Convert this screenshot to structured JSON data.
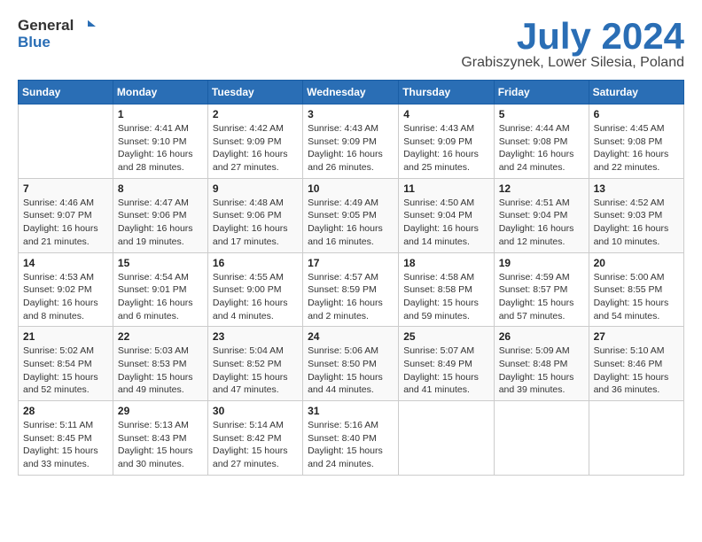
{
  "header": {
    "logo_general": "General",
    "logo_blue": "Blue",
    "month_title": "July 2024",
    "location": "Grabiszynek, Lower Silesia, Poland"
  },
  "calendar": {
    "days_of_week": [
      "Sunday",
      "Monday",
      "Tuesday",
      "Wednesday",
      "Thursday",
      "Friday",
      "Saturday"
    ],
    "weeks": [
      [
        {
          "day": "",
          "info": ""
        },
        {
          "day": "1",
          "info": "Sunrise: 4:41 AM\nSunset: 9:10 PM\nDaylight: 16 hours\nand 28 minutes."
        },
        {
          "day": "2",
          "info": "Sunrise: 4:42 AM\nSunset: 9:09 PM\nDaylight: 16 hours\nand 27 minutes."
        },
        {
          "day": "3",
          "info": "Sunrise: 4:43 AM\nSunset: 9:09 PM\nDaylight: 16 hours\nand 26 minutes."
        },
        {
          "day": "4",
          "info": "Sunrise: 4:43 AM\nSunset: 9:09 PM\nDaylight: 16 hours\nand 25 minutes."
        },
        {
          "day": "5",
          "info": "Sunrise: 4:44 AM\nSunset: 9:08 PM\nDaylight: 16 hours\nand 24 minutes."
        },
        {
          "day": "6",
          "info": "Sunrise: 4:45 AM\nSunset: 9:08 PM\nDaylight: 16 hours\nand 22 minutes."
        }
      ],
      [
        {
          "day": "7",
          "info": "Sunrise: 4:46 AM\nSunset: 9:07 PM\nDaylight: 16 hours\nand 21 minutes."
        },
        {
          "day": "8",
          "info": "Sunrise: 4:47 AM\nSunset: 9:06 PM\nDaylight: 16 hours\nand 19 minutes."
        },
        {
          "day": "9",
          "info": "Sunrise: 4:48 AM\nSunset: 9:06 PM\nDaylight: 16 hours\nand 17 minutes."
        },
        {
          "day": "10",
          "info": "Sunrise: 4:49 AM\nSunset: 9:05 PM\nDaylight: 16 hours\nand 16 minutes."
        },
        {
          "day": "11",
          "info": "Sunrise: 4:50 AM\nSunset: 9:04 PM\nDaylight: 16 hours\nand 14 minutes."
        },
        {
          "day": "12",
          "info": "Sunrise: 4:51 AM\nSunset: 9:04 PM\nDaylight: 16 hours\nand 12 minutes."
        },
        {
          "day": "13",
          "info": "Sunrise: 4:52 AM\nSunset: 9:03 PM\nDaylight: 16 hours\nand 10 minutes."
        }
      ],
      [
        {
          "day": "14",
          "info": "Sunrise: 4:53 AM\nSunset: 9:02 PM\nDaylight: 16 hours\nand 8 minutes."
        },
        {
          "day": "15",
          "info": "Sunrise: 4:54 AM\nSunset: 9:01 PM\nDaylight: 16 hours\nand 6 minutes."
        },
        {
          "day": "16",
          "info": "Sunrise: 4:55 AM\nSunset: 9:00 PM\nDaylight: 16 hours\nand 4 minutes."
        },
        {
          "day": "17",
          "info": "Sunrise: 4:57 AM\nSunset: 8:59 PM\nDaylight: 16 hours\nand 2 minutes."
        },
        {
          "day": "18",
          "info": "Sunrise: 4:58 AM\nSunset: 8:58 PM\nDaylight: 15 hours\nand 59 minutes."
        },
        {
          "day": "19",
          "info": "Sunrise: 4:59 AM\nSunset: 8:57 PM\nDaylight: 15 hours\nand 57 minutes."
        },
        {
          "day": "20",
          "info": "Sunrise: 5:00 AM\nSunset: 8:55 PM\nDaylight: 15 hours\nand 54 minutes."
        }
      ],
      [
        {
          "day": "21",
          "info": "Sunrise: 5:02 AM\nSunset: 8:54 PM\nDaylight: 15 hours\nand 52 minutes."
        },
        {
          "day": "22",
          "info": "Sunrise: 5:03 AM\nSunset: 8:53 PM\nDaylight: 15 hours\nand 49 minutes."
        },
        {
          "day": "23",
          "info": "Sunrise: 5:04 AM\nSunset: 8:52 PM\nDaylight: 15 hours\nand 47 minutes."
        },
        {
          "day": "24",
          "info": "Sunrise: 5:06 AM\nSunset: 8:50 PM\nDaylight: 15 hours\nand 44 minutes."
        },
        {
          "day": "25",
          "info": "Sunrise: 5:07 AM\nSunset: 8:49 PM\nDaylight: 15 hours\nand 41 minutes."
        },
        {
          "day": "26",
          "info": "Sunrise: 5:09 AM\nSunset: 8:48 PM\nDaylight: 15 hours\nand 39 minutes."
        },
        {
          "day": "27",
          "info": "Sunrise: 5:10 AM\nSunset: 8:46 PM\nDaylight: 15 hours\nand 36 minutes."
        }
      ],
      [
        {
          "day": "28",
          "info": "Sunrise: 5:11 AM\nSunset: 8:45 PM\nDaylight: 15 hours\nand 33 minutes."
        },
        {
          "day": "29",
          "info": "Sunrise: 5:13 AM\nSunset: 8:43 PM\nDaylight: 15 hours\nand 30 minutes."
        },
        {
          "day": "30",
          "info": "Sunrise: 5:14 AM\nSunset: 8:42 PM\nDaylight: 15 hours\nand 27 minutes."
        },
        {
          "day": "31",
          "info": "Sunrise: 5:16 AM\nSunset: 8:40 PM\nDaylight: 15 hours\nand 24 minutes."
        },
        {
          "day": "",
          "info": ""
        },
        {
          "day": "",
          "info": ""
        },
        {
          "day": "",
          "info": ""
        }
      ]
    ]
  }
}
